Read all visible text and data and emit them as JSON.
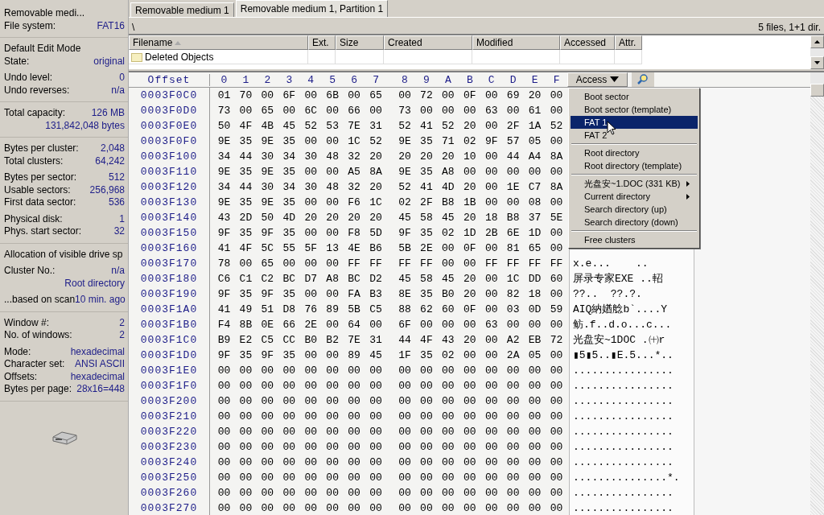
{
  "info_panel": {
    "sections": [
      {
        "groups": [
          [
            {
              "kind": "title",
              "text": "Removable medi..."
            },
            {
              "kind": "pair",
              "label": "File system:",
              "value": "FAT16"
            }
          ]
        ]
      },
      {
        "groups": [
          [
            {
              "kind": "title",
              "text": "Default Edit Mode"
            },
            {
              "kind": "pair",
              "label": "State:",
              "value": "original"
            }
          ],
          [
            {
              "kind": "pair",
              "label": "Undo level:",
              "value": "0"
            },
            {
              "kind": "pair",
              "label": "Undo reverses:",
              "value": "n/a"
            }
          ]
        ]
      },
      {
        "groups": [
          [
            {
              "kind": "pair",
              "label": "Total capacity:",
              "value": "126 MB"
            },
            {
              "kind": "value",
              "value": "131,842,048 bytes"
            }
          ]
        ]
      },
      {
        "groups": [
          [
            {
              "kind": "pair",
              "label": "Bytes per cluster:",
              "value": "2,048"
            },
            {
              "kind": "pair",
              "label": "Total clusters:",
              "value": "64,242"
            }
          ],
          [
            {
              "kind": "pair",
              "label": "Bytes per sector:",
              "value": "512"
            },
            {
              "kind": "pair",
              "label": "Usable sectors:",
              "value": "256,968"
            },
            {
              "kind": "pair",
              "label": "First data sector:",
              "value": "536"
            }
          ],
          [
            {
              "kind": "pair",
              "label": "Physical disk:",
              "value": "1"
            },
            {
              "kind": "pair",
              "label": "Phys. start sector:",
              "value": "32"
            }
          ]
        ]
      },
      {
        "groups": [
          [
            {
              "kind": "title",
              "text": "Allocation of visible drive sp"
            }
          ],
          [
            {
              "kind": "pair",
              "label": "Cluster No.:",
              "value": "n/a"
            },
            {
              "kind": "value",
              "value": "Root directory"
            }
          ],
          [
            {
              "kind": "pair",
              "label": "...based on scan",
              "value": "10 min. ago"
            }
          ]
        ]
      },
      {
        "groups": [
          [
            {
              "kind": "pair",
              "label": "Window #:",
              "value": "2"
            },
            {
              "kind": "pair",
              "label": "No. of windows:",
              "value": "2"
            }
          ],
          [
            {
              "kind": "pair",
              "label": "Mode:",
              "value": "hexadecimal"
            },
            {
              "kind": "pair",
              "label": "Character set:",
              "value": "ANSI ASCII"
            },
            {
              "kind": "pair",
              "label": "Offsets:",
              "value": "hexadecimal"
            },
            {
              "kind": "pair",
              "label": "Bytes per page:",
              "value": "28x16=448"
            }
          ]
        ]
      }
    ]
  },
  "tabs": [
    {
      "label": "Removable medium 1",
      "selected": false
    },
    {
      "label": "Removable medium 1, Partition 1",
      "selected": true
    }
  ],
  "path_bar": {
    "path": "\\",
    "summary": "5 files, 1+1 dir."
  },
  "file_table": {
    "columns": [
      "Filename",
      "Ext.",
      "Size",
      "Created",
      "Modified",
      "Accessed",
      "Attr."
    ],
    "rows": [
      {
        "name": "Deleted Objects"
      }
    ]
  },
  "hex_view": {
    "offset_header": "Offset",
    "columns": [
      "0",
      "1",
      "2",
      "3",
      "4",
      "5",
      "6",
      "7",
      "8",
      "9",
      "A",
      "B",
      "C",
      "D",
      "E",
      "F"
    ],
    "access_button": "Access",
    "rows": [
      {
        "offset": "0003F0C0",
        "bytes": [
          "01",
          "70",
          "00",
          "6F",
          "00",
          "6B",
          "00",
          "65",
          "00",
          "72",
          "00",
          "0F",
          "00",
          "69",
          "20",
          "00"
        ]
      },
      {
        "offset": "0003F0D0",
        "bytes": [
          "73",
          "00",
          "65",
          "00",
          "6C",
          "00",
          "66",
          "00",
          "73",
          "00",
          "00",
          "00",
          "63",
          "00",
          "61",
          "00"
        ]
      },
      {
        "offset": "0003F0E0",
        "bytes": [
          "50",
          "4F",
          "4B",
          "45",
          "52",
          "53",
          "7E",
          "31",
          "52",
          "41",
          "52",
          "20",
          "00",
          "2F",
          "1A",
          "52"
        ]
      },
      {
        "offset": "0003F0F0",
        "bytes": [
          "9E",
          "35",
          "9E",
          "35",
          "00",
          "00",
          "1C",
          "52",
          "9E",
          "35",
          "71",
          "02",
          "9F",
          "57",
          "05",
          "00"
        ]
      },
      {
        "offset": "0003F100",
        "bytes": [
          "34",
          "44",
          "30",
          "34",
          "30",
          "48",
          "32",
          "20",
          "20",
          "20",
          "20",
          "10",
          "00",
          "44",
          "A4",
          "8A"
        ]
      },
      {
        "offset": "0003F110",
        "bytes": [
          "9E",
          "35",
          "9E",
          "35",
          "00",
          "00",
          "A5",
          "8A",
          "9E",
          "35",
          "A8",
          "00",
          "00",
          "00",
          "00",
          "00"
        ]
      },
      {
        "offset": "0003F120",
        "bytes": [
          "34",
          "44",
          "30",
          "34",
          "30",
          "48",
          "32",
          "20",
          "52",
          "41",
          "4D",
          "20",
          "00",
          "1E",
          "C7",
          "8A"
        ]
      },
      {
        "offset": "0003F130",
        "bytes": [
          "9E",
          "35",
          "9E",
          "35",
          "00",
          "00",
          "F6",
          "1C",
          "02",
          "2F",
          "B8",
          "1B",
          "00",
          "00",
          "08",
          "00"
        ]
      },
      {
        "offset": "0003F140",
        "bytes": [
          "43",
          "2D",
          "50",
          "4D",
          "20",
          "20",
          "20",
          "20",
          "45",
          "58",
          "45",
          "20",
          "18",
          "B8",
          "37",
          "5E"
        ]
      },
      {
        "offset": "0003F150",
        "bytes": [
          "9F",
          "35",
          "9F",
          "35",
          "00",
          "00",
          "F8",
          "5D",
          "9F",
          "35",
          "02",
          "1D",
          "2B",
          "6E",
          "1D",
          "00"
        ]
      },
      {
        "offset": "0003F160",
        "bytes": [
          "41",
          "4F",
          "5C",
          "55",
          "5F",
          "13",
          "4E",
          "B6",
          "5B",
          "2E",
          "00",
          "0F",
          "00",
          "81",
          "65",
          "00"
        ]
      },
      {
        "offset": "0003F170",
        "bytes": [
          "78",
          "00",
          "65",
          "00",
          "00",
          "00",
          "FF",
          "FF",
          "FF",
          "FF",
          "00",
          "00",
          "FF",
          "FF",
          "FF",
          "FF"
        ],
        "ascii": "x.e...    .."
      },
      {
        "offset": "0003F180",
        "bytes": [
          "C6",
          "C1",
          "C2",
          "BC",
          "D7",
          "A8",
          "BC",
          "D2",
          "45",
          "58",
          "45",
          "20",
          "00",
          "1C",
          "DD",
          "60"
        ],
        "ascii": "屏录专家EXE ..軺"
      },
      {
        "offset": "0003F190",
        "bytes": [
          "9F",
          "35",
          "9F",
          "35",
          "00",
          "00",
          "FA",
          "B3",
          "8E",
          "35",
          "B0",
          "20",
          "00",
          "82",
          "18",
          "00"
        ],
        "ascii": "??..  ??.?."
      },
      {
        "offset": "0003F1A0",
        "bytes": [
          "41",
          "49",
          "51",
          "D8",
          "76",
          "89",
          "5B",
          "C5",
          "88",
          "62",
          "60",
          "0F",
          "00",
          "03",
          "0D",
          "59"
        ],
        "ascii": "AIQ納媨艌b`....Y"
      },
      {
        "offset": "0003F1B0",
        "bytes": [
          "F4",
          "8B",
          "0E",
          "66",
          "2E",
          "00",
          "64",
          "00",
          "6F",
          "00",
          "00",
          "00",
          "63",
          "00",
          "00",
          "00"
        ],
        "ascii": "鲂.f..d.o...c..."
      },
      {
        "offset": "0003F1C0",
        "bytes": [
          "B9",
          "E2",
          "C5",
          "CC",
          "B0",
          "B2",
          "7E",
          "31",
          "44",
          "4F",
          "43",
          "20",
          "00",
          "A2",
          "EB",
          "72"
        ],
        "ascii": "光盘安~1DOC .㈩r"
      },
      {
        "offset": "0003F1D0",
        "bytes": [
          "9F",
          "35",
          "9F",
          "35",
          "00",
          "00",
          "89",
          "45",
          "1F",
          "35",
          "02",
          "00",
          "00",
          "2A",
          "05",
          "00"
        ],
        "ascii": "▮5▮5..▮E.5...*.."
      },
      {
        "offset": "0003F1E0",
        "bytes": [
          "00",
          "00",
          "00",
          "00",
          "00",
          "00",
          "00",
          "00",
          "00",
          "00",
          "00",
          "00",
          "00",
          "00",
          "00",
          "00"
        ],
        "ascii": "................"
      },
      {
        "offset": "0003F1F0",
        "bytes": [
          "00",
          "00",
          "00",
          "00",
          "00",
          "00",
          "00",
          "00",
          "00",
          "00",
          "00",
          "00",
          "00",
          "00",
          "00",
          "00"
        ],
        "ascii": "................"
      },
      {
        "offset": "0003F200",
        "bytes": [
          "00",
          "00",
          "00",
          "00",
          "00",
          "00",
          "00",
          "00",
          "00",
          "00",
          "00",
          "00",
          "00",
          "00",
          "00",
          "00"
        ],
        "ascii": "................"
      },
      {
        "offset": "0003F210",
        "bytes": [
          "00",
          "00",
          "00",
          "00",
          "00",
          "00",
          "00",
          "00",
          "00",
          "00",
          "00",
          "00",
          "00",
          "00",
          "00",
          "00"
        ],
        "ascii": "................"
      },
      {
        "offset": "0003F220",
        "bytes": [
          "00",
          "00",
          "00",
          "00",
          "00",
          "00",
          "00",
          "00",
          "00",
          "00",
          "00",
          "00",
          "00",
          "00",
          "00",
          "00"
        ],
        "ascii": "................"
      },
      {
        "offset": "0003F230",
        "bytes": [
          "00",
          "00",
          "00",
          "00",
          "00",
          "00",
          "00",
          "00",
          "00",
          "00",
          "00",
          "00",
          "00",
          "00",
          "00",
          "00"
        ],
        "ascii": "................"
      },
      {
        "offset": "0003F240",
        "bytes": [
          "00",
          "00",
          "00",
          "00",
          "00",
          "00",
          "00",
          "00",
          "00",
          "00",
          "00",
          "00",
          "00",
          "00",
          "00",
          "00"
        ],
        "ascii": "................"
      },
      {
        "offset": "0003F250",
        "bytes": [
          "00",
          "00",
          "00",
          "00",
          "00",
          "00",
          "00",
          "00",
          "00",
          "00",
          "00",
          "00",
          "00",
          "00",
          "00",
          "00"
        ],
        "ascii": "...............*."
      },
      {
        "offset": "0003F260",
        "bytes": [
          "00",
          "00",
          "00",
          "00",
          "00",
          "00",
          "00",
          "00",
          "00",
          "00",
          "00",
          "00",
          "00",
          "00",
          "00",
          "00"
        ],
        "ascii": "................"
      },
      {
        "offset": "0003F270",
        "bytes": [
          "00",
          "00",
          "00",
          "00",
          "00",
          "00",
          "00",
          "00",
          "00",
          "00",
          "00",
          "00",
          "00",
          "00",
          "00",
          "00"
        ],
        "ascii": "................"
      }
    ]
  },
  "access_menu": {
    "groups": [
      [
        {
          "label": "Boot sector",
          "selected": false,
          "submenu": false
        },
        {
          "label": "Boot sector (template)",
          "selected": false,
          "submenu": false
        },
        {
          "label": "FAT 1",
          "selected": true,
          "submenu": false
        },
        {
          "label": "FAT 2",
          "selected": false,
          "submenu": false
        }
      ],
      [
        {
          "label": "Root directory",
          "selected": false,
          "submenu": false
        },
        {
          "label": "Root directory (template)",
          "selected": false,
          "submenu": false
        }
      ],
      [
        {
          "label": "光盘安~1.DOC (331 KB)",
          "selected": false,
          "submenu": true
        },
        {
          "label": "Current directory",
          "selected": false,
          "submenu": true
        },
        {
          "label": "Search directory (up)",
          "selected": false,
          "submenu": false
        },
        {
          "label": "Search directory (down)",
          "selected": false,
          "submenu": false
        }
      ],
      [
        {
          "label": "Free clusters",
          "selected": false,
          "submenu": false
        }
      ]
    ]
  }
}
